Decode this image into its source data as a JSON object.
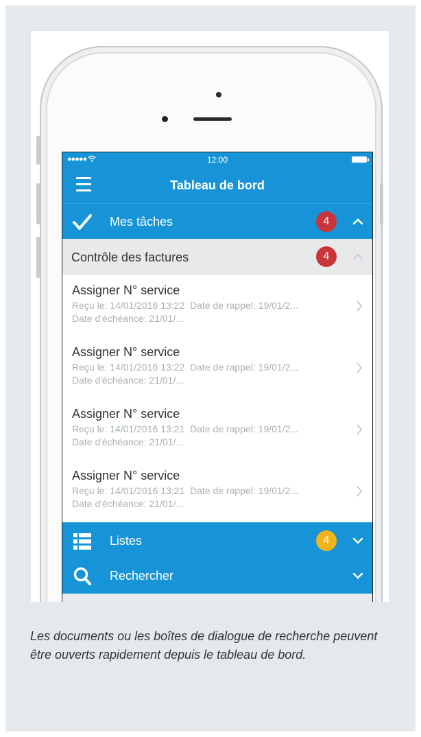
{
  "colors": {
    "primary": "#1694d7",
    "badge_red": "#c8363a",
    "badge_yellow": "#f5b31b",
    "background": "#e6e9ec"
  },
  "status_bar": {
    "signal": "●●●●● ",
    "time": "12:00"
  },
  "navbar": {
    "title": "Tableau de bord",
    "menu_icon": "hamburger-icon"
  },
  "tasks": {
    "label": "Mes tâches",
    "badge": "4",
    "icon": "checkmark-icon"
  },
  "invoices": {
    "label": "Contrôle des factures",
    "badge": "4"
  },
  "items": [
    {
      "title": "Assigner N° service",
      "received": "Reçu le: 14/01/2016 13:22",
      "reminder": "Date de rappel: 19/01/2...",
      "due": "Date d'échéance: 21/01/..."
    },
    {
      "title": "Assigner N° service",
      "received": "Reçu le: 14/01/2016 13:22",
      "reminder": "Date de rappel: 19/01/2...",
      "due": "Date d'échéance: 21/01/..."
    },
    {
      "title": "Assigner N° service",
      "received": "Reçu le: 14/01/2016 13:21",
      "reminder": "Date de rappel: 19/01/2...",
      "due": "Date d'échéance: 21/01/..."
    },
    {
      "title": "Assigner N° service",
      "received": "Reçu le: 14/01/2016 13:21",
      "reminder": "Date de rappel: 19/01/2...",
      "due": "Date d'échéance: 21/01/..."
    }
  ],
  "lists": {
    "label": "Listes",
    "badge": "4",
    "icon": "list-icon"
  },
  "search": {
    "label": "Rechercher",
    "icon": "search-icon"
  },
  "caption": "Les documents ou les boîtes de dialogue de recherche peuvent être ouverts rapidement depuis le tableau de bord."
}
